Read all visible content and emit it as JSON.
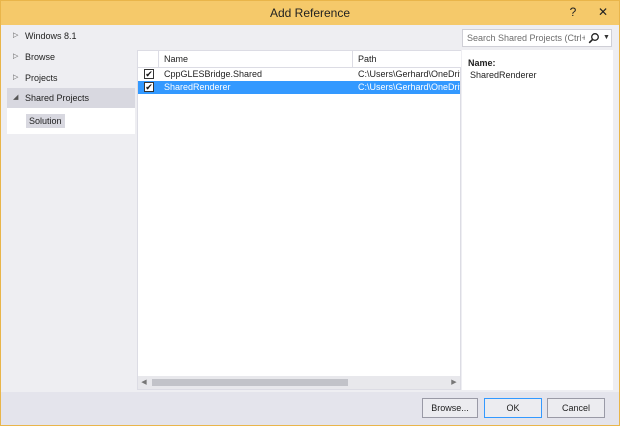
{
  "window": {
    "title": "Add Reference",
    "help_label": "?",
    "close_label": "✕"
  },
  "sidebar": {
    "items": [
      {
        "label": "Windows 8.1",
        "arrow": "▷"
      },
      {
        "label": "Browse",
        "arrow": "▷"
      },
      {
        "label": "Projects",
        "arrow": "▷"
      },
      {
        "label": "Shared Projects",
        "arrow": "◢"
      }
    ],
    "sub_items": [
      {
        "label": "Solution"
      }
    ]
  },
  "search": {
    "placeholder": "Search Shared Projects (Ctrl+"
  },
  "table": {
    "columns": [
      "Name",
      "Path"
    ],
    "rows": [
      {
        "checked": true,
        "check_glyph": "✔",
        "name": "CppGLESBridge.Shared",
        "path": "C:\\Users\\Gerhard\\OneDrive"
      },
      {
        "checked": true,
        "check_glyph": "✔",
        "name": "SharedRenderer",
        "path": "C:\\Users\\Gerhard\\OneDrive"
      }
    ],
    "scroll_left": "◀",
    "scroll_right": "▶"
  },
  "details": {
    "name_label": "Name:",
    "name_value": "SharedRenderer"
  },
  "buttons": {
    "browse": "Browse...",
    "ok": "OK",
    "cancel": "Cancel"
  },
  "colors": {
    "titlebar": "#f5c96a",
    "selection": "#3399ff",
    "panel": "#eeeef2"
  }
}
